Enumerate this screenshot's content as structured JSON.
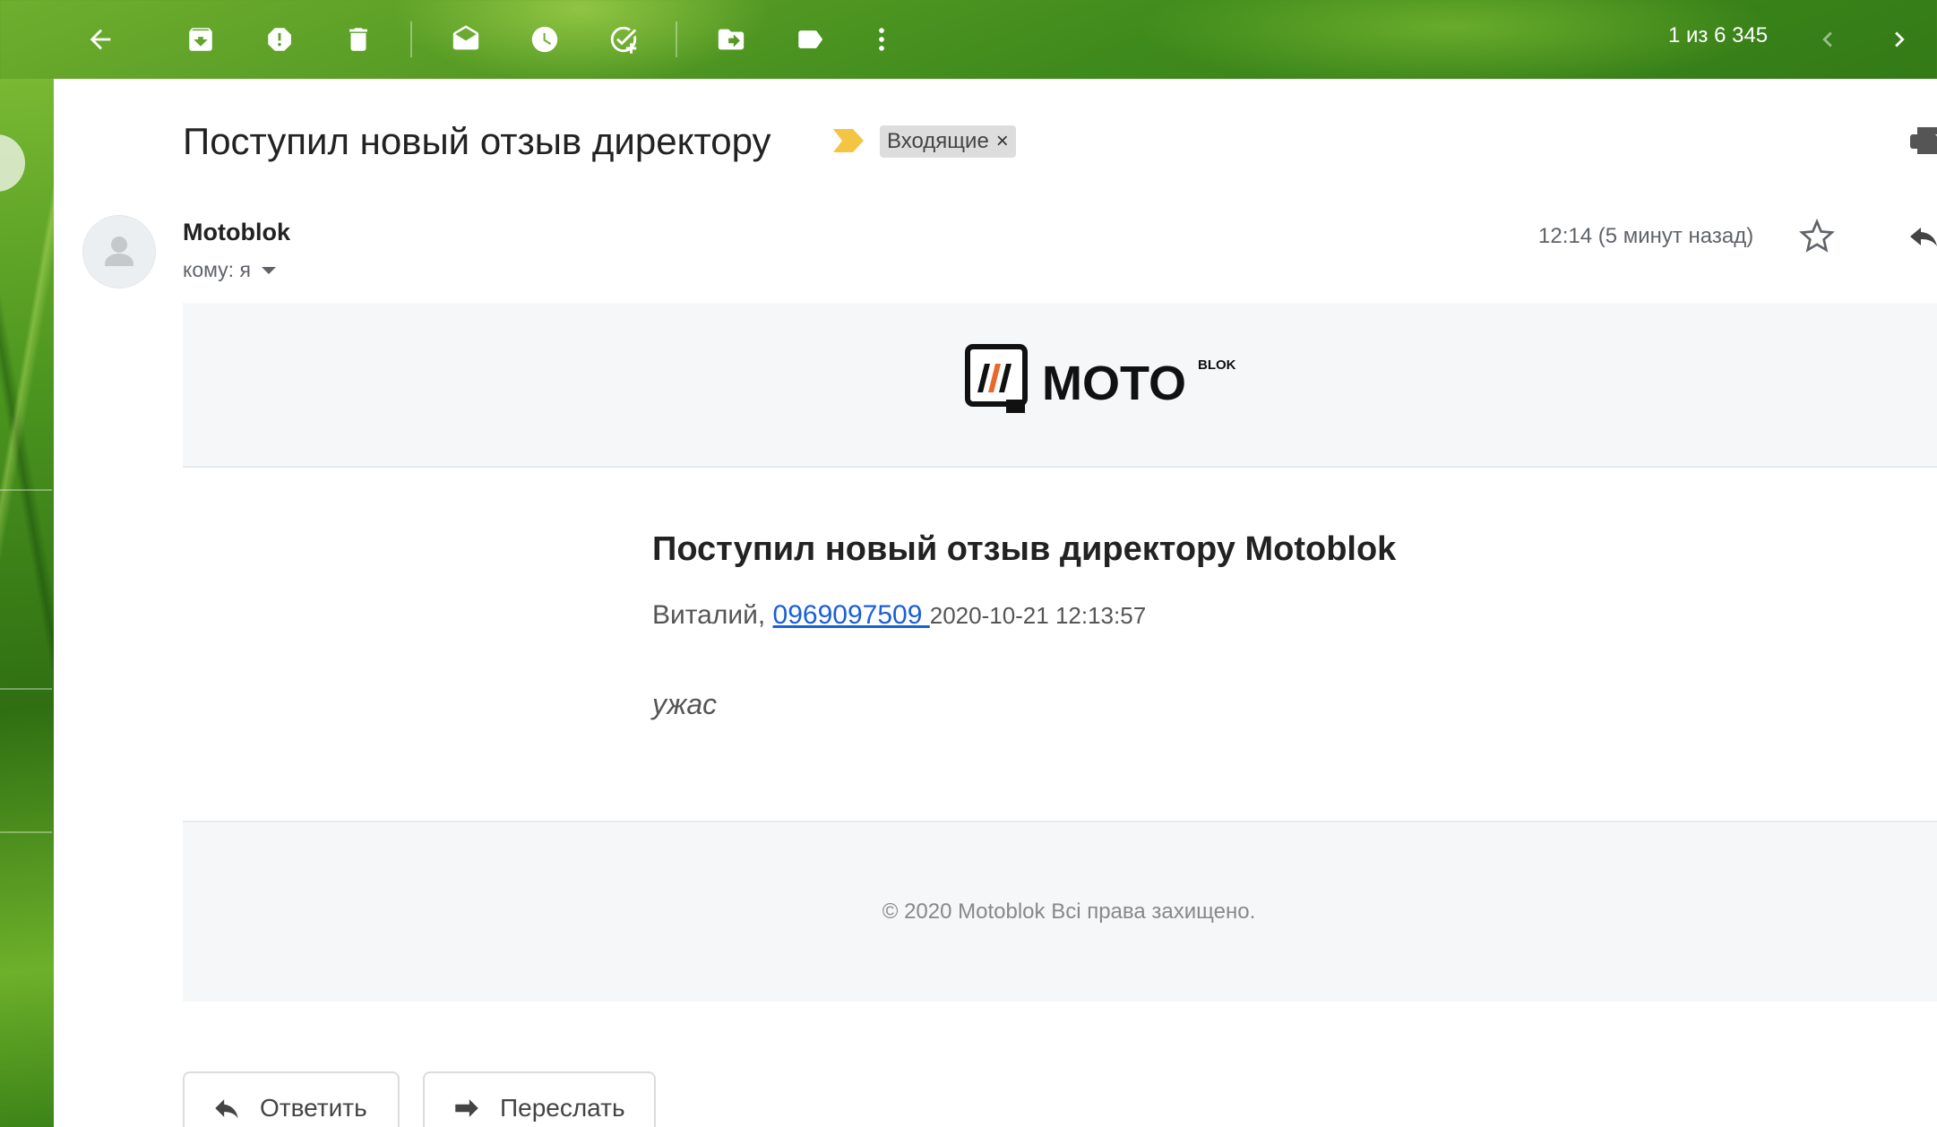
{
  "toolbar": {
    "icons": [
      "back-arrow-icon",
      "archive-icon",
      "report-spam-icon",
      "trash-icon",
      "mark-unread-icon",
      "snooze-icon",
      "add-task-icon",
      "move-to-icon",
      "label-icon",
      "more-vert-icon"
    ],
    "pager": "1 из 6 345"
  },
  "message": {
    "subject": "Поступил новый отзыв директору",
    "label": "Входящие",
    "label_remove": "×",
    "sender": "Motoblok",
    "to": "кому: я",
    "timestamp": "12:14 (5 минут назад)"
  },
  "email_body": {
    "logo_text": "MOTO",
    "logo_sup": "BLOK",
    "title": "Поступил новый отзыв директору Motoblok",
    "name": "Виталий, ",
    "phone": "0969097509 ",
    "datetime": "2020-10-21 12:13:57",
    "review": "ужас",
    "footer": "© 2020 Motoblok Всі права захищено."
  },
  "actions": {
    "reply": "Ответить",
    "forward": "Переслать"
  },
  "colors": {
    "link": "#1a5fd6",
    "importance": "#f4c542",
    "logo_accent": "#e8692a"
  }
}
